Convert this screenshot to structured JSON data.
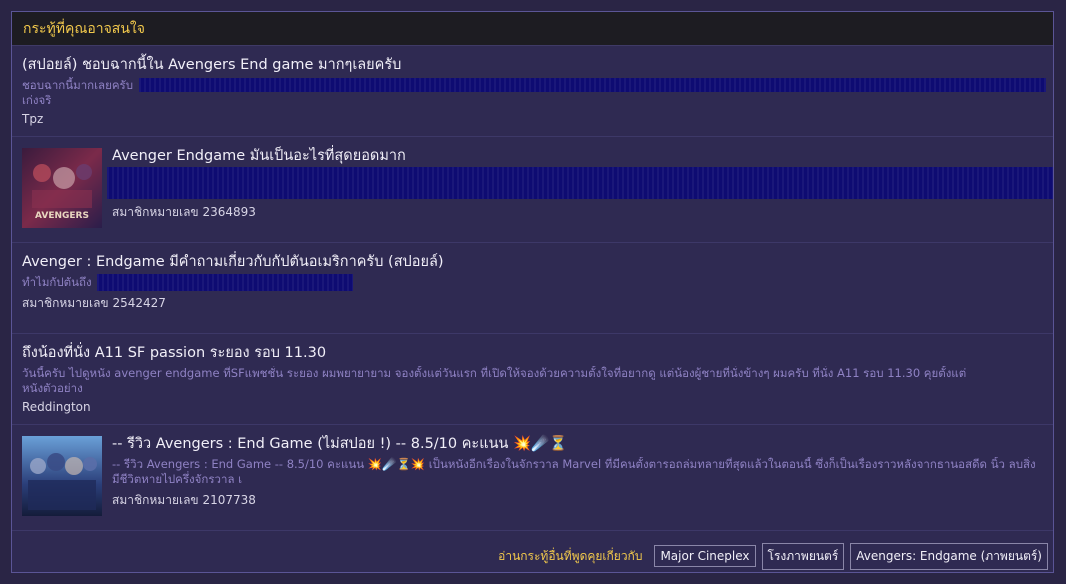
{
  "header": {
    "title": "กระทู้ที่คุณอาจสนใจ"
  },
  "topics": [
    {
      "title": "(สปอยล์) ชอบฉากนี้ใน Avengers End game มากๆเลยครับ",
      "excerpt_line1": "ชอบฉากนี้มากเลยครับ",
      "excerpt_line2": "เก่งจริ",
      "author": "Tpz"
    },
    {
      "title": "Avenger Endgame มันเป็นอะไรที่สุดยอดมาก",
      "author": "สมาชิกหมายเลข 2364893",
      "thumb_text": "AVENGERS"
    },
    {
      "title": "Avenger : Endgame มีคำถามเกี่ยวกับกัปตันอเมริกาครับ (สปอยล์)",
      "excerpt_line1": "ทำไมกัปตันถึง",
      "author": "สมาชิกหมายเลข 2542427"
    },
    {
      "title": "ถึงน้องที่นั่ง A11 SF passion ระยอง รอบ 11.30",
      "excerpt_line1": "วันนี้ครับ ไปดูหนัง avenger endgame ที่SFแพชชั่น ระยอง ผมพยายายาม จองตั้งแต่วันแรก ที่เปิดให้จองด้วยความตั้งใจที่อยากดู แต่น้องผู้ชายที่นั่งข้างๆ ผมครับ ที่นั่ง A11 รอบ 11.30 คุยตั้งแต่",
      "excerpt_line2": "หนังตัวอย่าง",
      "author": "Reddington"
    },
    {
      "title": "-- รีวิว Avengers : End Game (ไม่สปอย !) -- 8.5/10 คะแนน 💥☄️⏳",
      "excerpt_line1": "-- รีวิว Avengers : End Game -- 8.5/10 คะแนน 💥☄️⏳💥 เป็นหนังอีกเรื่องในจักรวาล Marvel ที่มีคนตั้งตารอถล่มทลายที่สุดแล้วในตอนนี้ ซึ่งก็เป็นเรื่องราวหลังจากธานอสดีด",
      "excerpt_line2": "นิ้ว ลบสิ่งมีชีวิตหายไปครึ่งจักรวาล เ",
      "author": "สมาชิกหมายเลข 2107738"
    }
  ],
  "footer": {
    "label": "อ่านกระทู้อื่นที่พูดคุยเกี่ยวกับ",
    "tags": [
      "Major Cineplex",
      "โรงภาพยนตร์",
      "Avengers: Endgame (ภาพยนตร์)"
    ]
  },
  "colors": {
    "accent": "#f2c94c",
    "panel_bg": "#2f2a52",
    "excerpt": "#8f82c4",
    "redaction": "#0e0b72"
  }
}
